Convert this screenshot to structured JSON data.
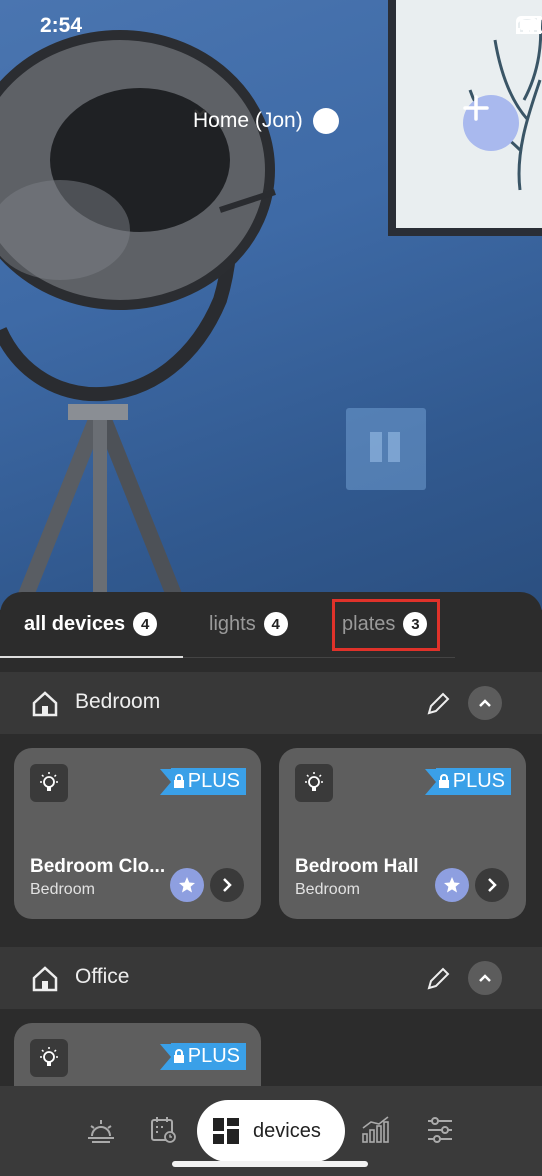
{
  "status_bar": {
    "time": "2:54"
  },
  "header": {
    "home_label": "Home (Jon)"
  },
  "tabs": [
    {
      "label": "all devices",
      "count": "4"
    },
    {
      "label": "lights",
      "count": "4"
    },
    {
      "label": "plates",
      "count": "3"
    }
  ],
  "rooms": [
    {
      "name": "Bedroom",
      "devices": [
        {
          "name": "Bedroom Clo...",
          "room": "Bedroom",
          "badge": "PLUS"
        },
        {
          "name": "Bedroom Hall",
          "room": "Bedroom",
          "badge": "PLUS"
        }
      ]
    },
    {
      "name": "Office",
      "devices": [
        {
          "badge": "PLUS"
        }
      ]
    }
  ],
  "bottom_nav": {
    "active_label": "devices"
  },
  "colors": {
    "accent": "#a9b9ee",
    "badge": "#3aa0e8",
    "highlight": "#e0322a"
  }
}
